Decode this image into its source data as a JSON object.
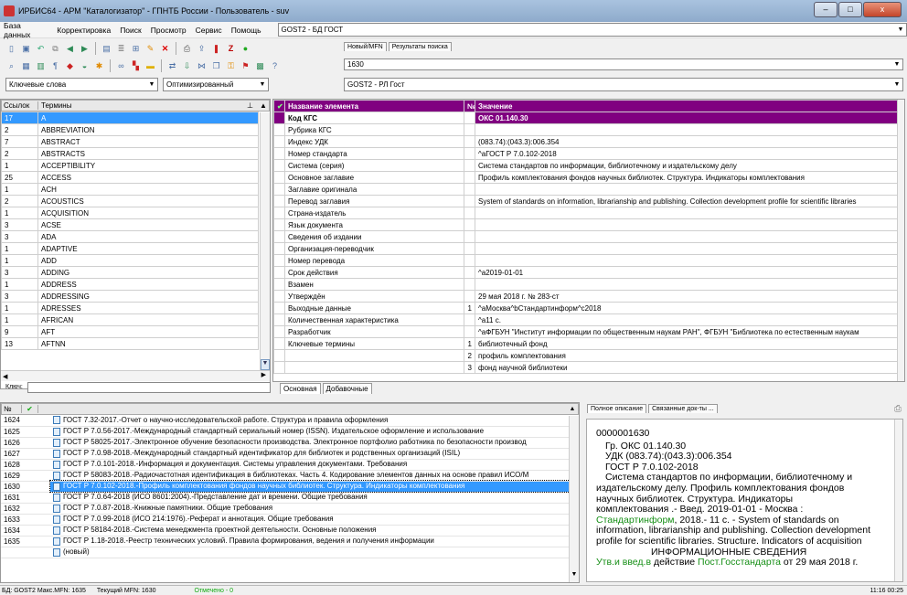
{
  "window": {
    "title": "ИРБИС64 - АРМ \"Каталогизатор\" - ГПНТБ России - Пользователь - suv",
    "min": "–",
    "max": "□",
    "close": "x"
  },
  "menu": [
    "База данных",
    "Корректировка",
    "Поиск",
    "Просмотр",
    "Сервис",
    "Помощь"
  ],
  "db_combo": "GOST2 - БД ГОСТ",
  "toolbar_tabs": [
    "Новый/MFN",
    "Результаты поиска"
  ],
  "mfn_input": "1630",
  "search": {
    "mode": "Ключевые слова",
    "method": "Оптимизированный",
    "worksheet": "GOST2 - РЛ Гост",
    "key_label": "Ключ:",
    "key_value": ""
  },
  "dictionary": {
    "col_count": "Ссылок",
    "col_term": "Термины",
    "rows": [
      {
        "count": "17",
        "term": "A"
      },
      {
        "count": "2",
        "term": "ABBREVIATION"
      },
      {
        "count": "7",
        "term": "ABSTRACT"
      },
      {
        "count": "2",
        "term": "ABSTRACTS"
      },
      {
        "count": "1",
        "term": "ACCEPTIBILITY"
      },
      {
        "count": "25",
        "term": "ACCESS"
      },
      {
        "count": "1",
        "term": "ACH"
      },
      {
        "count": "2",
        "term": "ACOUSTICS"
      },
      {
        "count": "1",
        "term": "ACQUISITION"
      },
      {
        "count": "3",
        "term": "ACSE"
      },
      {
        "count": "3",
        "term": "ADA"
      },
      {
        "count": "1",
        "term": "ADAPTIVE"
      },
      {
        "count": "1",
        "term": "ADD"
      },
      {
        "count": "3",
        "term": "ADDING"
      },
      {
        "count": "1",
        "term": "ADDRESS"
      },
      {
        "count": "3",
        "term": "ADDRESSING"
      },
      {
        "count": "1",
        "term": "ADRESSES"
      },
      {
        "count": "1",
        "term": "AFRICAN"
      },
      {
        "count": "9",
        "term": "AFT"
      },
      {
        "count": "13",
        "term": "AFTNN"
      }
    ]
  },
  "record": {
    "col_name": "Название элемента",
    "col_no": "№",
    "col_value": "Значение",
    "rows": [
      {
        "name": "Код КГС",
        "no": "",
        "value": "ОКС 01.140.30"
      },
      {
        "name": "Рубрика КГС",
        "no": "",
        "value": ""
      },
      {
        "name": "Индекс УДК",
        "no": "",
        "value": "(083.74):(043.3):006.354"
      },
      {
        "name": "Номер стандарта",
        "no": "",
        "value": "^aГОСТ Р 7.0.102-2018"
      },
      {
        "name": "Система (серия)",
        "no": "",
        "value": "Система стандартов по информации, библиотечному и издательскому делу"
      },
      {
        "name": "Основное заглавие",
        "no": "",
        "value": "Профиль комплектования фондов научных библиотек. Структура. Индикаторы комплектования"
      },
      {
        "name": "Заглавие оригинала",
        "no": "",
        "value": ""
      },
      {
        "name": "Перевод заглавия",
        "no": "",
        "value": "System of standards on information, librarianship and publishing. Collection development profile for scientific libraries"
      },
      {
        "name": "Страна-издатель",
        "no": "",
        "value": ""
      },
      {
        "name": "Язык документа",
        "no": "",
        "value": ""
      },
      {
        "name": "Сведения об издании",
        "no": "",
        "value": ""
      },
      {
        "name": "Организация-переводчик",
        "no": "",
        "value": ""
      },
      {
        "name": "Номер перевода",
        "no": "",
        "value": ""
      },
      {
        "name": "Срок действия",
        "no": "",
        "value": "^a2019-01-01"
      },
      {
        "name": "Взамен",
        "no": "",
        "value": ""
      },
      {
        "name": "Утверждён",
        "no": "",
        "value": "29 мая 2018 г. № 283-ст"
      },
      {
        "name": "Выходные данные",
        "no": "1",
        "value": "^aМосква^bСтандартинформ^c2018"
      },
      {
        "name": "Количественная характеристика",
        "no": "",
        "value": "^a11 с."
      },
      {
        "name": "Разработчик",
        "no": "",
        "value": "^aФГБУН \"Институт информации по общественным наукам РАН\",  ФГБУН \"Библиотека по естественным наукам"
      },
      {
        "name": "Ключевые термины",
        "no": "1",
        "value": "библиотечный фонд"
      },
      {
        "name": "",
        "no": "2",
        "value": "профиль комплектования"
      },
      {
        "name": "",
        "no": "3",
        "value": "фонд научной библиотеки"
      }
    ],
    "tabs": [
      "Основная",
      "Добавочные"
    ]
  },
  "results": {
    "col_no": "№",
    "check": "✔",
    "rows": [
      {
        "mfn": "1624",
        "text": "ГОСТ 7.32-2017.-Отчет о научно-исследовательской работе. Структура и правила оформления"
      },
      {
        "mfn": "1625",
        "text": "ГОСТ Р 7.0.56-2017.-Международный стандартный сериальный номер (ISSN). Издательское оформление и использование"
      },
      {
        "mfn": "1626",
        "text": "ГОСТ Р 58025-2017.-Электронное обучение безопасности производства. Электронное портфолио работника по безопасности производ"
      },
      {
        "mfn": "1627",
        "text": "ГОСТ Р 7.0.98-2018.-Международный стандартный идентификатор для библиотек и родственных организаций (ISIL)"
      },
      {
        "mfn": "1628",
        "text": "ГОСТ Р 7.0.101-2018.-Информация и документация. Системы управления документами. Требования"
      },
      {
        "mfn": "1629",
        "text": "ГОСТ Р 58083-2018.-Радиочастотная идентификация в библиотеках. Часть 4. Кодирование элементов данных на основе правил ИСО/М"
      },
      {
        "mfn": "1630",
        "text": "ГОСТ Р 7.0.102-2018.-Профиль комплектования фондов научных библиотек. Структура. Индикаторы комплектования"
      },
      {
        "mfn": "1631",
        "text": "ГОСТ Р 7.0.64-2018  (ИСО 8601:2004).-Представление дат и времени. Общие требования"
      },
      {
        "mfn": "1632",
        "text": "ГОСТ Р 7.0.87-2018.-Книжные памятники. Общие требования"
      },
      {
        "mfn": "1633",
        "text": "ГОСТ Р 7.0.99-2018 (ИСО 214:1976).-Реферат и аннотация. Общие требования"
      },
      {
        "mfn": "1634",
        "text": "ГОСТ Р 58184-2018.-Система менеджмента проектной деятельности. Основные положения"
      },
      {
        "mfn": "1635",
        "text": "ГОСТ Р 1.18-2018.-Реестр технических условий. Правила формирования, ведения и получения информации"
      },
      {
        "mfn": "",
        "text": "(новый)"
      }
    ]
  },
  "fullview": {
    "tabs": [
      "Полное описание",
      "Связанные док-ты ..."
    ],
    "lines": [
      {
        "text": "0000001630",
        "cls": "",
        "indent": 0
      },
      {
        "text": "Гр. ОКС 01.140.30",
        "cls": "",
        "indent": 10
      },
      {
        "text": "УДК (083.74):(043.3):006.354",
        "cls": "",
        "indent": 10
      },
      {
        "text": "ГОСТ Р 7.0.102-2018",
        "cls": "",
        "indent": 10
      },
      {
        "text": "Система стандартов по информации, библиотечному и",
        "cls": "",
        "indent": 10
      },
      {
        "text": "издательскому делу. Профиль комплектования фондов",
        "cls": "",
        "indent": 0
      },
      {
        "text": "научных библиотек. Структура. Индикаторы",
        "cls": "",
        "indent": 0
      },
      {
        "text": "комплектования .- Введ. 2019-01-01 - Москва :",
        "cls": "",
        "indent": 0
      }
    ],
    "l9a": "Стандартинформ",
    "l9b": ", 2018.- 11 с. - System of standards on",
    "l10": "information, librarianship and publishing. Collection development",
    "l11": "profile for scientific libraries. Structure. Indicators of acquisition",
    "l12": "ИНФОРМАЦИОННЫЕ СВЕДЕНИЯ",
    "l13a": "Утв.и введ.в",
    "l13b": " действие ",
    "l13c": "Пост.Госстандарта",
    "l13d": " от 29 мая 2018 г."
  },
  "status": {
    "db": "БД: GOST2 Макс.MFN: 1635",
    "cur": "Текущий MFN: 1630",
    "marked": "Отмечено - 0",
    "time": "11:16  00:25"
  }
}
